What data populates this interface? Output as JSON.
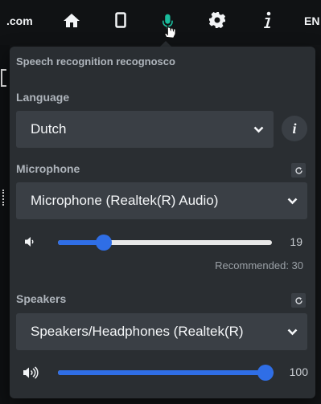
{
  "topbar": {
    "site_fragment": ".com",
    "language_code": "EN",
    "icons": [
      "home-icon",
      "mobile-icon",
      "microphone-icon",
      "gear-icon",
      "info-icon"
    ],
    "active_icon_color": "#1abc9c"
  },
  "panel": {
    "header": "Speech recognition recognosco",
    "language": {
      "label": "Language",
      "selected": "Dutch",
      "info_button": "i"
    },
    "microphone": {
      "label": "Microphone",
      "selected": "Microphone (Realtek(R) Audio)",
      "volume": 19,
      "volume_max": 100,
      "volume_display": "19",
      "recommended_text": "Recommended: 30"
    },
    "speakers": {
      "label": "Speakers",
      "selected": "Speakers/Headphones (Realtek(R)",
      "volume": 100,
      "volume_max": 100,
      "volume_display": "100"
    }
  },
  "colors": {
    "panel_bg": "#2a2e32",
    "select_bg": "#3a3f45",
    "slider_accent": "#2f6ee6",
    "slider_track": "#e8e8e8"
  }
}
